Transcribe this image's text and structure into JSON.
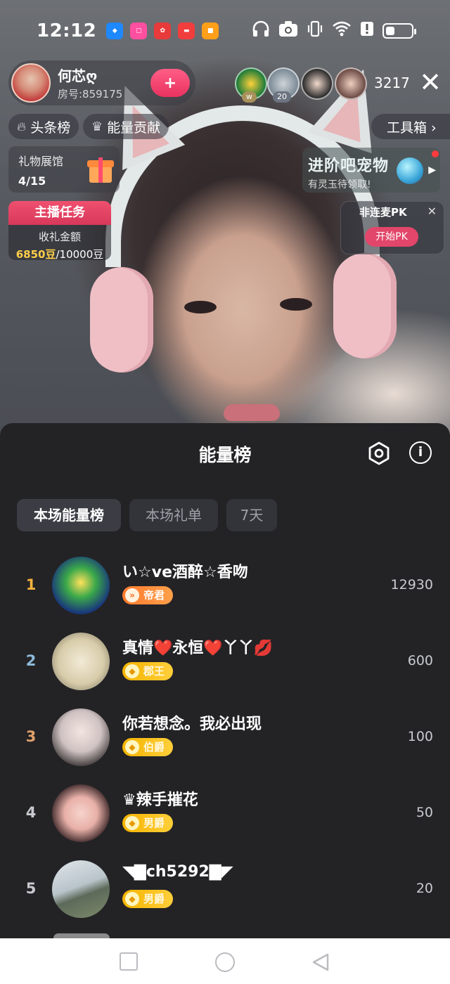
{
  "status_bar": {
    "time": "12:12",
    "apps": [
      {
        "icon": "shield-app-icon",
        "color": "#1e88ff"
      },
      {
        "icon": "square-app-icon",
        "color": "#ff4fa0"
      },
      {
        "icon": "huawei-app-icon",
        "color": "#e83a3a"
      },
      {
        "icon": "toutiao-app-icon",
        "color": "#f23d3d"
      },
      {
        "icon": "game-app-icon",
        "color": "#ff9f1a"
      }
    ]
  },
  "host": {
    "name": "何芯ღ",
    "room": "房号:859175",
    "follow_label": "+"
  },
  "viewers": {
    "badges": [
      "w",
      "20"
    ],
    "count": "3217"
  },
  "chips": {
    "headline_rank": "头条榜",
    "energy_contrib": "能量贡献",
    "toolbox": "工具箱 ›"
  },
  "gift_hall": {
    "title": "礼物展馆",
    "progress": "4/15"
  },
  "host_task": {
    "title": "主播任务",
    "label": "收礼金额",
    "current": "6850豆",
    "total": "/10000豆"
  },
  "promo": {
    "title": "进阶吧宠物",
    "subtitle": "有灵玉待领取!"
  },
  "pk": {
    "mode": "非连麦PK",
    "start_label": "开始PK"
  },
  "sheet": {
    "title": "能量榜",
    "tabs": [
      "本场能量榜",
      "本场礼单",
      "7天"
    ],
    "rows": [
      {
        "rank": "1",
        "name": "い☆ve酒醉☆香吻",
        "badge": "帝君",
        "score": "12930",
        "rank_color": "#f4b23c",
        "badge_style": "orange"
      },
      {
        "rank": "2",
        "name": "真情❤️永恒❤️丫丫💋",
        "badge": "郡王",
        "score": "600",
        "rank_color": "#8fb9d9",
        "badge_style": "gold"
      },
      {
        "rank": "3",
        "name": "你若想念。我必出现",
        "badge": "伯爵",
        "score": "100",
        "rank_color": "#e0a16a",
        "badge_style": "gold"
      },
      {
        "rank": "4",
        "name": "♛辣手摧花",
        "badge": "男爵",
        "score": "50",
        "rank_color": "#c9cacf",
        "badge_style": "gold"
      },
      {
        "rank": "5",
        "name": "◥▇ch5292▇◤",
        "badge": "男爵",
        "score": "20",
        "rank_color": "#c9cacf",
        "badge_style": "gold"
      }
    ]
  },
  "colors": {
    "accent_pink": "#e2466a",
    "sheet_bg": "#232326",
    "gold": "#ffcf4a"
  }
}
